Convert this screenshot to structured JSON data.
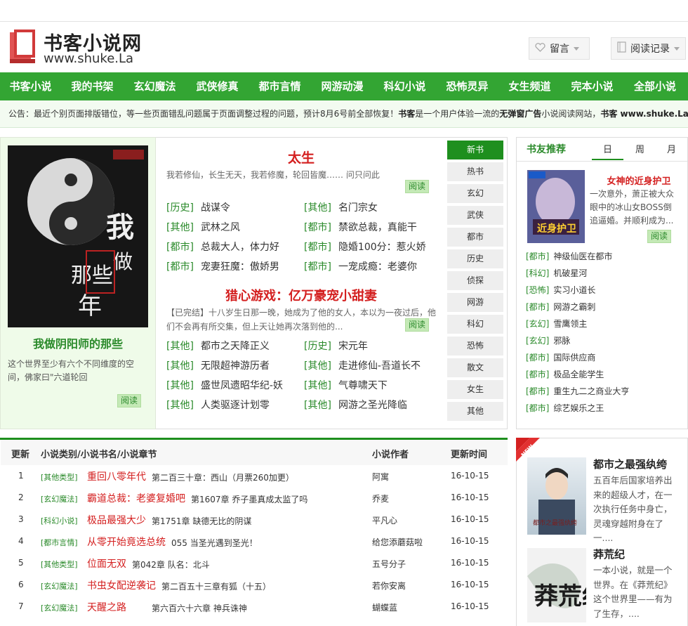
{
  "header": {
    "logo_title": "书客小说网",
    "logo_domain": "www.shuke.La",
    "message_label": "留言",
    "history_label": "阅读记录"
  },
  "nav": [
    "书客小说",
    "我的书架",
    "玄幻魔法",
    "武侠修真",
    "都市言情",
    "网游动漫",
    "科幻小说",
    "恐怖灵异",
    "女生频道",
    "完本小说",
    "全部小说"
  ],
  "notice": {
    "prefix": "公告：最近个别页面排版错位，等一些页面错乱问题属于页面调整过程的问题，预计8月6号前全部恢复！",
    "brand1": "书客",
    "mid": "是一个用户体验一流的",
    "adfree": "无弹窗广告",
    "mid2": "小说阅读网站，",
    "brand2": "书客 www.shuke.La"
  },
  "featured": {
    "title": "我做阴阳师的那些",
    "desc": "这个世界至少有六个不同维度的空间，佛家曰\"六道轮回",
    "read_label": "阅读",
    "cover_text": "我做阴阳师的那些年"
  },
  "middle": {
    "book1": {
      "title": "太生",
      "desc": "我若修仙，长生无天，我若修魔，轮回皆魔…… 问只问此",
      "read_label": "阅读"
    },
    "list1": [
      {
        "cat": "[历史]",
        "name": "战谋令"
      },
      {
        "cat": "[其他]",
        "name": "名门宗女"
      },
      {
        "cat": "[其他]",
        "name": "武林之风"
      },
      {
        "cat": "[都市]",
        "name": "禁欲总裁，真能干"
      },
      {
        "cat": "[都市]",
        "name": "总裁大人，体力好"
      },
      {
        "cat": "[都市]",
        "name": "隐婚100分：惹火娇"
      },
      {
        "cat": "[都市]",
        "name": "宠妻狂魔：傲娇男"
      },
      {
        "cat": "[都市]",
        "name": "一宠成瘾：老婆你"
      }
    ],
    "book2": {
      "title": "猎心游戏：亿万豪宠小甜妻",
      "desc": "【已完结】十八岁生日那一晚，她成为了他的女人，本以为一夜过后，他们不会再有所交集，但上天让她再次落到他的...",
      "read_label": "阅读"
    },
    "list2": [
      {
        "cat": "[其他]",
        "name": "都市之天降正义"
      },
      {
        "cat": "[历史]",
        "name": "宋元年"
      },
      {
        "cat": "[其他]",
        "name": "无限超神游历者"
      },
      {
        "cat": "[其他]",
        "name": "走进修仙-吾道长不"
      },
      {
        "cat": "[其他]",
        "name": "盛世凤遗昭华纪-妖"
      },
      {
        "cat": "[其他]",
        "name": "气尊啸天下"
      },
      {
        "cat": "[其他]",
        "name": "人类驱逐计划零"
      },
      {
        "cat": "[其他]",
        "name": "网游之圣光降临"
      }
    ],
    "tabs": [
      "新书",
      "热书",
      "玄幻",
      "武侠",
      "都市",
      "历史",
      "侦探",
      "网游",
      "科幻",
      "恐怖",
      "散文",
      "女生",
      "其他"
    ]
  },
  "recommend": {
    "title": "书友推荐",
    "tabs": [
      "日",
      "周",
      "月"
    ],
    "top": {
      "name": "女神的近身护卫",
      "desc": "一次意外，萧正被大众眼中的冰山女BOSS倒追逼婚。并顺利成为...",
      "read_label": "阅读",
      "cover_text": "近身护卫"
    },
    "list": [
      {
        "cat": "[都市]",
        "name": "神级仙医在都市"
      },
      {
        "cat": "[科幻]",
        "name": "机破星河"
      },
      {
        "cat": "[恐怖]",
        "name": "实习小道长"
      },
      {
        "cat": "[都市]",
        "name": "网游之霸刺"
      },
      {
        "cat": "[玄幻]",
        "name": "雪鹰领主"
      },
      {
        "cat": "[玄幻]",
        "name": "邪脉"
      },
      {
        "cat": "[都市]",
        "name": "国际供应商"
      },
      {
        "cat": "[都市]",
        "name": "极品全能学生"
      },
      {
        "cat": "[都市]",
        "name": "重生九二之商业大亨"
      },
      {
        "cat": "[都市]",
        "name": "综艺娱乐之王"
      }
    ]
  },
  "updates": {
    "headers": [
      "更新",
      "小说类别/小说书名/小说章节",
      "小说作者",
      "更新时间"
    ],
    "rows": [
      {
        "num": "1",
        "cat": "[其他类型]",
        "book": "重回八零年代",
        "chapter": "第二百三十章：西山（月票260加更）",
        "author": "阿寓",
        "time": "16-10-15"
      },
      {
        "num": "2",
        "cat": "[玄幻魔法]",
        "book": "霸道总裁：老婆复婚吧",
        "chapter": "第1607章 乔子墨真成太监了吗",
        "author": "乔麦",
        "time": "16-10-15"
      },
      {
        "num": "3",
        "cat": "[科幻小说]",
        "book": "极品最强大少",
        "chapter": "第1751章 缺德无比的阴谋",
        "author": "平凡心",
        "time": "16-10-15"
      },
      {
        "num": "4",
        "cat": "[都市言情]",
        "book": "从零开始竟选总统",
        "chapter": "055 当圣光遇到圣光！",
        "author": "给您添蘑菇啦",
        "time": "16-10-15"
      },
      {
        "num": "5",
        "cat": "[其他类型]",
        "book": "位面无双",
        "chapter": "第042章 队名：北斗",
        "author": "五号分子",
        "time": "16-10-15"
      },
      {
        "num": "6",
        "cat": "[玄幻魔法]",
        "book": "书虫女配逆袭记",
        "chapter": "第二百五十三章有狐（十五）",
        "author": "若你安离",
        "time": "16-10-15"
      },
      {
        "num": "7",
        "cat": "[玄幻魔法]",
        "book": "天醒之路",
        "chapter": "第六百六十六章 神兵诛神",
        "author": "蝴蝶蓝",
        "time": "16-10-15"
      }
    ]
  },
  "right2": {
    "badge": "NEW",
    "items": [
      {
        "name": "都市之最强纨绔",
        "desc": "五百年后国家培养出来的超级人才，在一次执行任务中身亡，灵魂穿越附身在了一....",
        "cover_text": "都市之最强纨绔"
      },
      {
        "name": "莽荒纪",
        "desc": "一本小说，就是一个世界。在《莽荒纪》这个世界里——有为了生存，....",
        "cover_text": "莽荒纪"
      }
    ]
  },
  "colors": {
    "green_nav": "#33a533",
    "accent_red": "#d42020",
    "category_green": "#2a8a2a"
  }
}
